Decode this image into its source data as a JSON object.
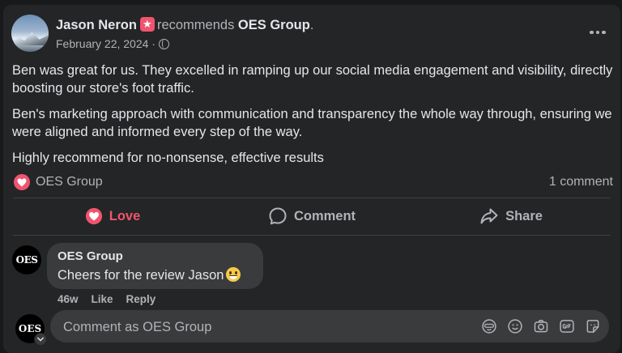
{
  "post": {
    "author": "Jason Neron",
    "verb": "recommends",
    "target": "OES Group",
    "date": "February 22, 2024",
    "date_sep": "·",
    "paragraphs": [
      "Ben was great for us. They excelled in ramping up our social media engagement and visibility, directly boosting our store's foot traffic.",
      "Ben's marketing approach with communication and transparency the whole way through, ensuring we were aligned and informed every step of the way.",
      "Highly recommend for no-nonsense, effective results"
    ],
    "reactions": {
      "name": "OES Group",
      "comment_count": "1 comment"
    }
  },
  "actions": {
    "love": "Love",
    "comment": "Comment",
    "share": "Share"
  },
  "comment": {
    "author": "OES Group",
    "text": "Cheers for the review Jason",
    "time": "46w",
    "like": "Like",
    "reply": "Reply",
    "avatar_text": "OES"
  },
  "composer": {
    "placeholder": "Comment as OES Group",
    "avatar_text": "OES"
  },
  "colors": {
    "accent_love": "#f0546f",
    "background": "#242526",
    "text": "#e4e6eb",
    "muted": "#b0b3b8"
  },
  "icons": [
    "star-badge-icon",
    "globe-icon",
    "more-options-icon",
    "heart-icon",
    "comment-icon",
    "share-icon",
    "chevron-down-icon",
    "avatar-icon",
    "emoji-icon",
    "camera-icon",
    "gif-icon",
    "sticker-icon",
    "grin-emoji"
  ]
}
